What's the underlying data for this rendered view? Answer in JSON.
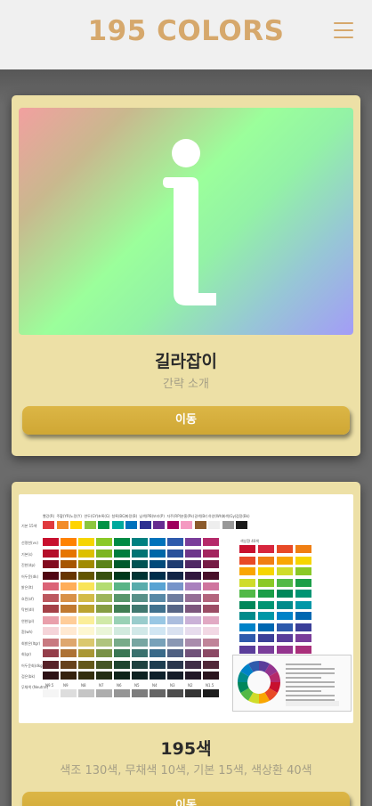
{
  "header": {
    "brand": "195 COLORS"
  },
  "cards": [
    {
      "title": "길라잡이",
      "subtitle": "간략 소개",
      "button_label": "이동"
    },
    {
      "title": "195색",
      "subtitle": "색조 130색, 무채색 10색, 기본 15색, 색상환 40색",
      "button_label": "이동"
    }
  ],
  "chart_image": {
    "header_labels": [
      "빨강(R)",
      "주황(YR)",
      "노랑(Y)",
      "연두(GY)",
      "초록(G)",
      "청록(BG)",
      "파랑(B)",
      "남색(PB)",
      "보라(P)",
      "자주(RP)",
      "분홍(Pk)",
      "갈색(Br)",
      "하양(Wh)",
      "회색(Gy)",
      "검정(Bk)"
    ],
    "basic_row_label": "기본 15색",
    "row_labels": [
      "선명한(vv)",
      "기본(s)",
      "진한(dp)",
      "어두운(dk)",
      "밝은(lt)",
      "흐린(sf)",
      "탁한(dl)",
      "연한(pl)",
      "흰(wh)",
      "회밝은(ltgr)",
      "회(gr)",
      "어두운회(dkgr)",
      "검은(bk)"
    ],
    "neutral_label": "무채색 (Neutral)",
    "neutral_labels": [
      "N9.5",
      "N9",
      "N8",
      "N7",
      "N6",
      "N5",
      "N4",
      "N3",
      "N2",
      "N1.5"
    ],
    "hue_circle_title": "색상환 40색",
    "colors": {
      "vivid": [
        "#c8102e",
        "#ff8200",
        "#f6d500",
        "#8ac926",
        "#008b45",
        "#008080",
        "#0072bb",
        "#2e5aac",
        "#7a3d9a",
        "#b5296a"
      ],
      "basic15": [
        "#e03a3e",
        "#f28c28",
        "#ffd400",
        "#8cc63f",
        "#009245",
        "#00a99d",
        "#0071bc",
        "#2e3192",
        "#662d91",
        "#9e005d",
        "#f49ac1",
        "#8b5a2b",
        "#ffffff",
        "#999999",
        "#1a1a1a"
      ]
    }
  }
}
